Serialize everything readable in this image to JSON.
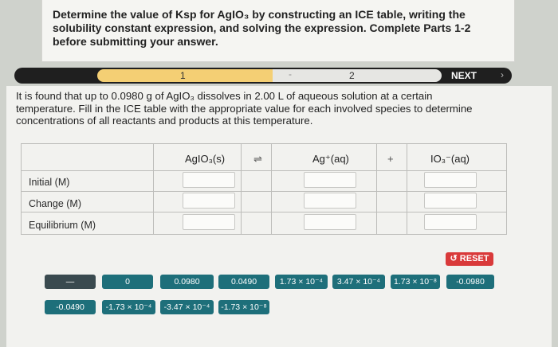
{
  "question": "Determine the value of Ksp for AgIO₃ by constructing an ICE table, writing the solubility constant expression, and solving the expression. Complete Parts 1-2 before submitting your answer.",
  "progress": {
    "step1": "1",
    "step2": "2",
    "next_label": "NEXT",
    "next_chevron": "›"
  },
  "prompt": "It is found that up to 0.0980 g of AgIO₃ dissolves in 2.00 L of aqueous solution at a certain temperature. Fill in the ICE table with the appropriate value for each involved species to determine concentrations of all reactants and products at this temperature.",
  "table": {
    "headers": [
      "AgIO₃(s)",
      "⇌",
      "Ag⁺(aq)",
      "+",
      "IO₃⁻(aq)"
    ],
    "rows": [
      "Initial (M)",
      "Change (M)",
      "Equilibrium (M)"
    ]
  },
  "reset_label": "↺ RESET",
  "tiles_row1": [
    "—",
    "0",
    "0.0980",
    "0.0490",
    "1.73 × 10⁻⁴",
    "3.47 × 10⁻⁴",
    "1.73 × 10⁻⁸",
    "-0.0980"
  ],
  "tiles_row2": [
    "-0.0490",
    "-1.73 × 10⁻⁴",
    "-3.47 × 10⁻⁴",
    "-1.73 × 10⁻⁸"
  ]
}
